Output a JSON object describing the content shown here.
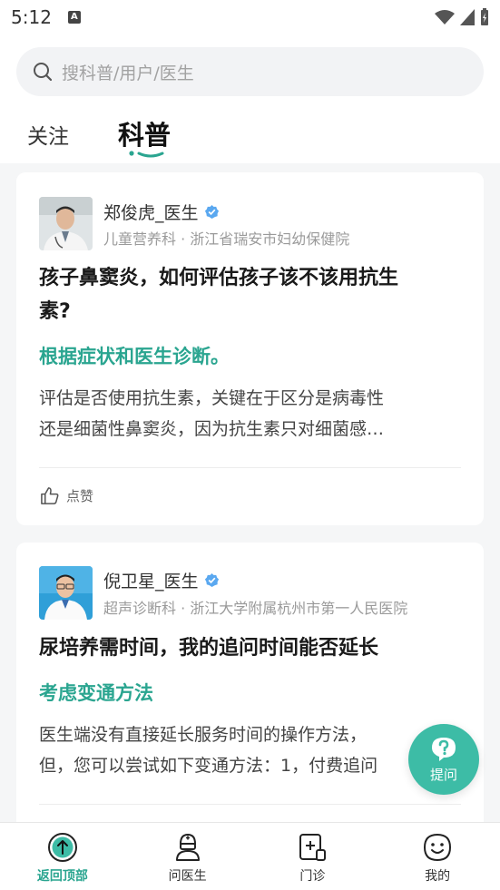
{
  "status_bar": {
    "time": "5:12",
    "notification_glyph": "A"
  },
  "search": {
    "placeholder": "搜科普/用户/医生"
  },
  "tabs": [
    {
      "label": "关注",
      "active": false
    },
    {
      "label": "科普",
      "active": true
    }
  ],
  "cards": [
    {
      "doctor_name": "郑俊虎_医生",
      "verified": true,
      "meta": "儿童营养科 · 浙江省瑞安市妇幼保健院",
      "question_line1": "孩子鼻窦炎，如何评估孩子该不该用抗生",
      "question_line2": "素?",
      "answer": "根据症状和医生诊断。",
      "excerpt_line1": "评估是否使用抗生素，关键在于区分是病毒性",
      "excerpt_line2": "还是细菌性鼻窦炎，因为抗生素只对细菌感…",
      "like_label": "点赞"
    },
    {
      "doctor_name": "倪卫星_医生",
      "verified": true,
      "meta": "超声诊断科 · 浙江大学附属杭州市第一人民医院",
      "question_line1": "尿培养需时间，我的追问时间能否延长",
      "answer": "考虑变通方法",
      "excerpt_line1": "医生端没有直接延长服务时间的操作方法，",
      "excerpt_line2": "但，您可以尝试如下变通方法：1，付费追问"
    }
  ],
  "ask_button": {
    "label": "提问"
  },
  "bottom_nav": [
    {
      "label": "返回顶部",
      "icon": "arrow-up-circle-icon",
      "active": true
    },
    {
      "label": "问医生",
      "icon": "doctor-icon",
      "active": false
    },
    {
      "label": "门诊",
      "icon": "clinic-icon",
      "active": false
    },
    {
      "label": "我的",
      "icon": "smiley-icon",
      "active": false
    }
  ],
  "colors": {
    "accent": "#2aa590",
    "fab": "#3dbca6",
    "verified": "#5aa8f0"
  }
}
